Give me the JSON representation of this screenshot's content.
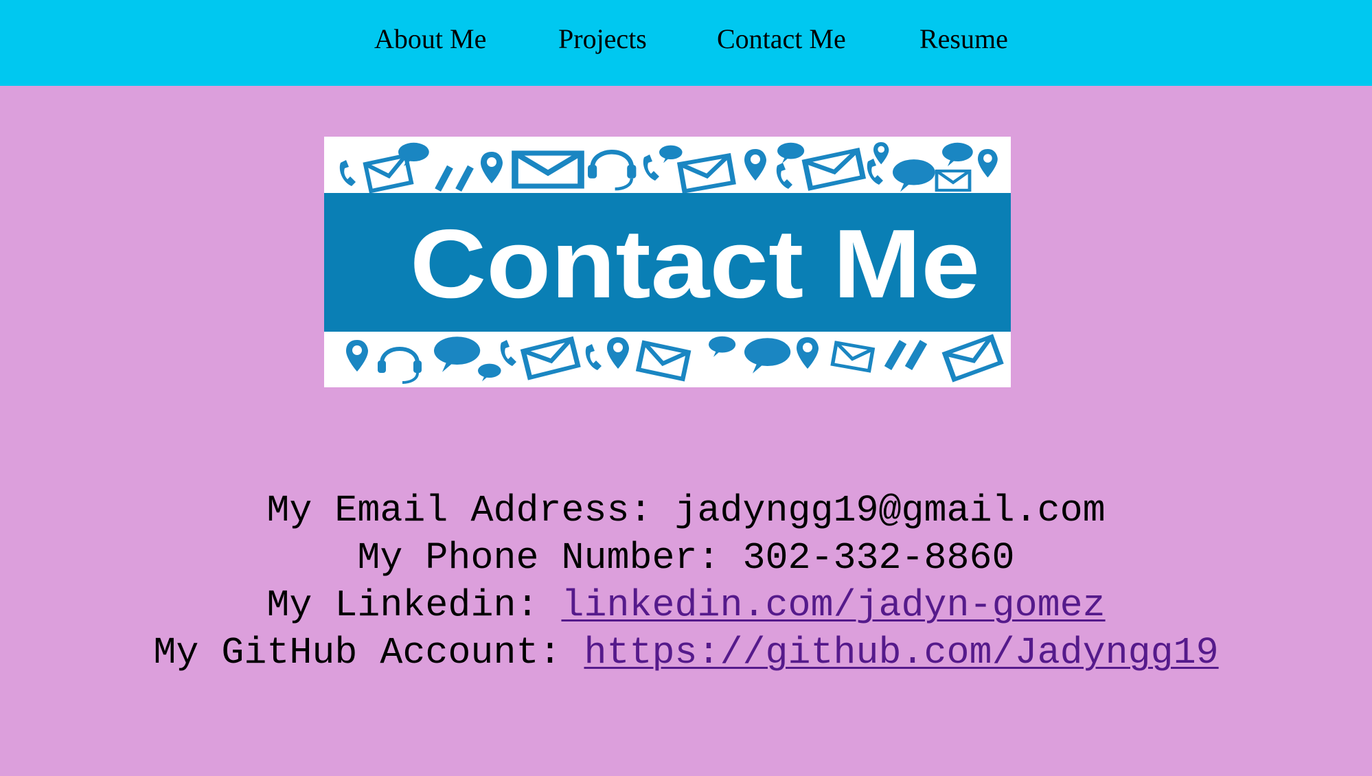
{
  "nav": {
    "items": [
      {
        "label": "About Me"
      },
      {
        "label": "Projects"
      },
      {
        "label": "Contact Me"
      },
      {
        "label": "Resume"
      }
    ]
  },
  "banner": {
    "text": "Contact Me",
    "colors": {
      "band": "#0a7fb5",
      "icons": "#1a86c2",
      "background": "#ffffff",
      "text": "#ffffff"
    },
    "icons": [
      "phone-icon",
      "envelope-icon",
      "speech-bubble-icon",
      "map-pin-icon",
      "headset-icon"
    ]
  },
  "contact": {
    "email_label": "My Email Address: ",
    "email_value": "jadyngg19@gmail.com",
    "phone_label": "My Phone Number: ",
    "phone_value": "302-332-8860",
    "linkedin_label": "My Linkedin: ",
    "linkedin_link": "linkedin.com/jadyn-gomez",
    "github_label": "My GitHub Account: ",
    "github_link": "https://github.com/Jadyngg19"
  },
  "colors": {
    "page_background": "#dc9fdc",
    "navbar_background": "#00c8f0",
    "link": "#551a8b"
  }
}
